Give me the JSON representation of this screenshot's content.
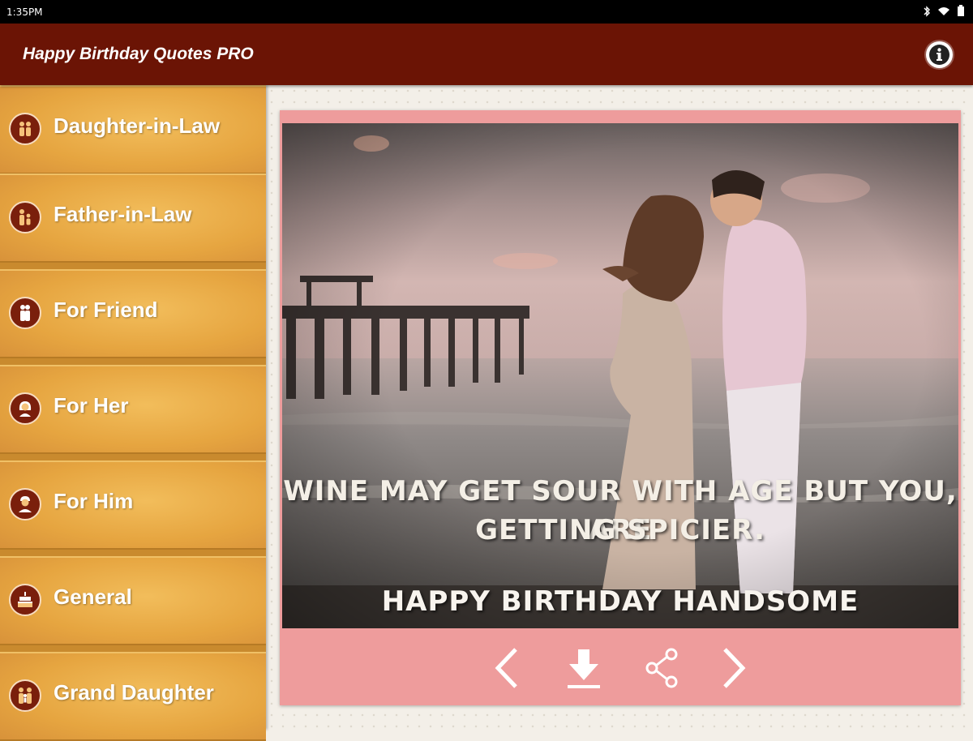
{
  "status_bar": {
    "time": "1:35PM"
  },
  "app_bar": {
    "title": "Happy Birthday Quotes PRO"
  },
  "sidebar": {
    "items": [
      {
        "label": "Daughter-in-Law",
        "icon": "couple-icon"
      },
      {
        "label": "Father-in-Law",
        "icon": "parent-child-icon"
      },
      {
        "label": "For Friend",
        "icon": "friends-icon"
      },
      {
        "label": "For Her",
        "icon": "woman-icon"
      },
      {
        "label": "For Him",
        "icon": "man-icon"
      },
      {
        "label": "General",
        "icon": "cake-icon"
      },
      {
        "label": "Grand Daughter",
        "icon": "family-icon"
      }
    ]
  },
  "card": {
    "quote_line1": "WINE MAY GET SOUR WITH AGE BUT YOU, ARE",
    "quote_line2": "GETTING SPICIER.",
    "tagline": "HAPPY BIRTHDAY HANDSOME"
  },
  "colors": {
    "app_bar": "#6b1405",
    "sidebar": "#e6a540",
    "card_frame": "#ee9c9c"
  }
}
